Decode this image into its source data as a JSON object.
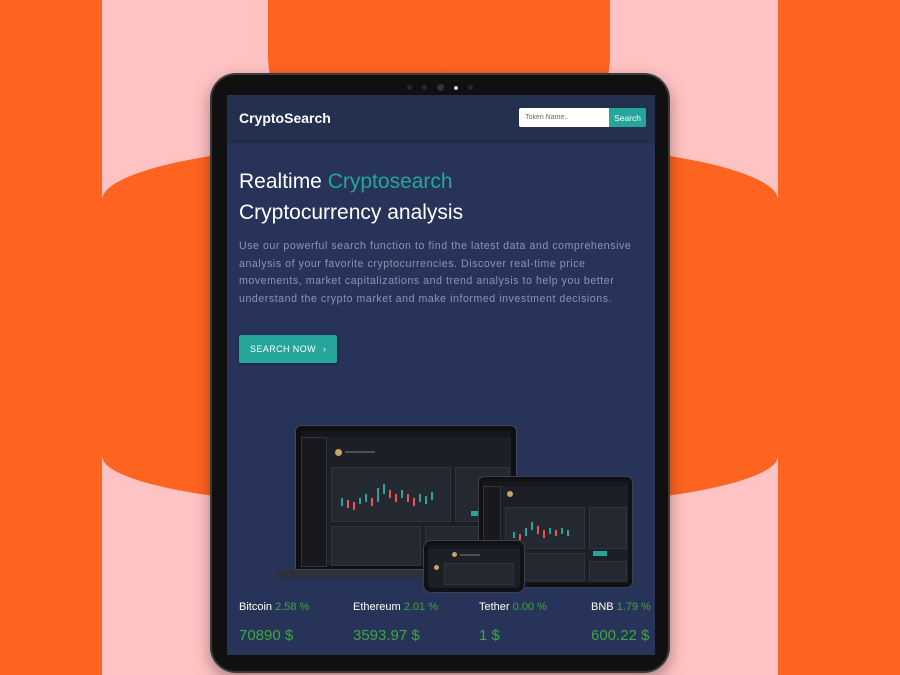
{
  "app": {
    "brand": "CryptoSearch"
  },
  "search": {
    "placeholder": "Token Name..",
    "button_label": "Search"
  },
  "hero": {
    "headline_prefix": "Realtime",
    "headline_accent": "Cryptosearch",
    "headline_line2": "Cryptocurrency analysis",
    "description": "Use our powerful search function to find the latest data and comprehensive analysis of your favorite cryptocurrencies. Discover real-time price movements, market capitalizations and trend analysis to help you better understand the crypto market and make informed investment decisions.",
    "cta_label": "SEARCH NOW",
    "cta_icon": "chevron-right-icon"
  },
  "tickers": [
    {
      "name": "Bitcoin",
      "change": "2.58 %",
      "price": "70890 $"
    },
    {
      "name": "Ethereum",
      "change": "2.01 %",
      "price": "3593.97 $"
    },
    {
      "name": "Tether",
      "change": "0.00 %",
      "price": "1 $"
    },
    {
      "name": "BNB",
      "change": "1.79 %",
      "price": "600.22 $"
    }
  ],
  "colors": {
    "background_orange": "#ff6320",
    "background_pink": "#ffc3c4",
    "screen_bg": "#273358",
    "navbar_bg": "#24304f",
    "accent_teal": "#26a69a",
    "positive_green": "#3fa640"
  }
}
